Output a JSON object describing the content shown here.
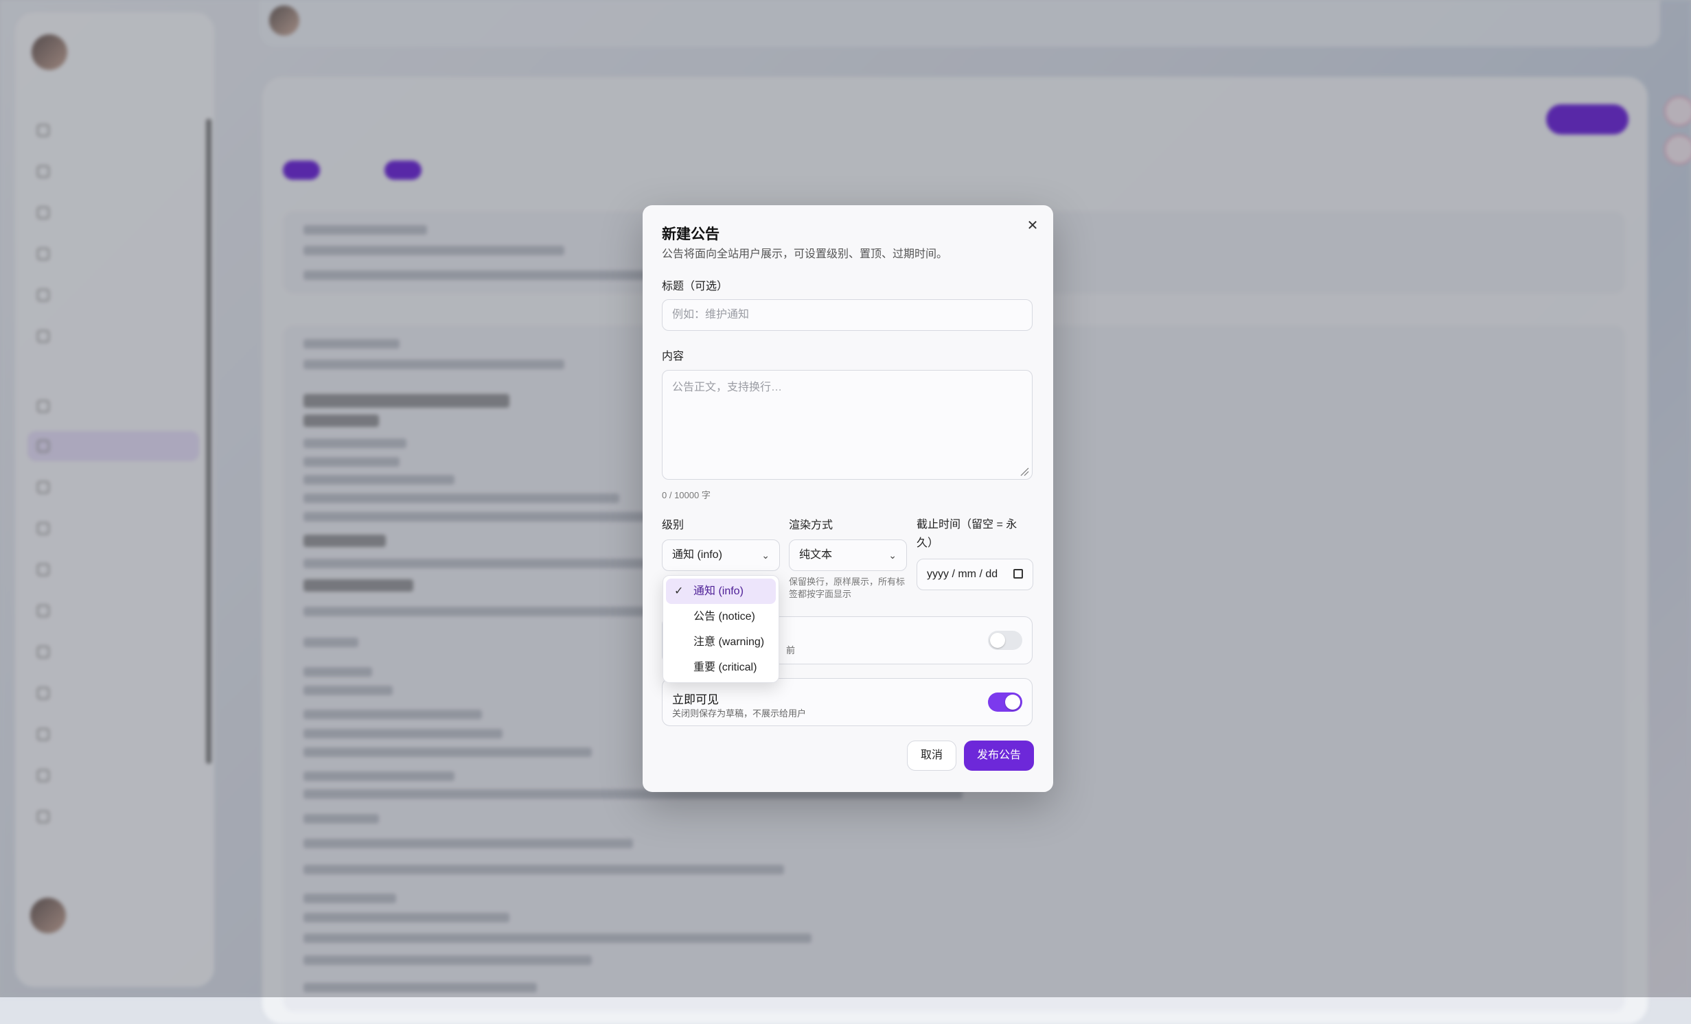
{
  "modal": {
    "title": "新建公告",
    "description": "公告将面向全站用户展示，可设置级别、置顶、过期时间。",
    "title_field": {
      "label": "标题（可选）",
      "placeholder": "例如：维护通知"
    },
    "content_field": {
      "label": "内容",
      "placeholder": "公告正文，支持换行…",
      "counter": "0 / 10000 字"
    },
    "level": {
      "label": "级别",
      "value": "通知 (info)",
      "options": [
        {
          "label": "通知 (info)",
          "selected": true
        },
        {
          "label": "公告 (notice)",
          "selected": false
        },
        {
          "label": "注意 (warning)",
          "selected": false
        },
        {
          "label": "重要 (critical)",
          "selected": false
        }
      ]
    },
    "render": {
      "label": "渲染方式",
      "value": "纯文本",
      "hint": "保留换行，原样展示，所有标签都按字面显示"
    },
    "expiry": {
      "label": "截止时间（留空 = 永久）",
      "placeholder": "yyyy / mm / dd"
    },
    "pin": {
      "desc_partial": "前",
      "enabled": false
    },
    "visible": {
      "title": "立即可见",
      "desc": "关闭则保存为草稿，不展示给用户",
      "enabled": true
    },
    "buttons": {
      "cancel": "取消",
      "publish": "发布公告"
    }
  },
  "colors": {
    "accent": "#7c3aed",
    "accent_dark": "#6d28d9",
    "selected_bg": "#ede5fb"
  },
  "icons": {
    "close": "close-icon",
    "chevron": "chevron-down-icon",
    "check": "check-icon",
    "calendar": "calendar-icon"
  }
}
